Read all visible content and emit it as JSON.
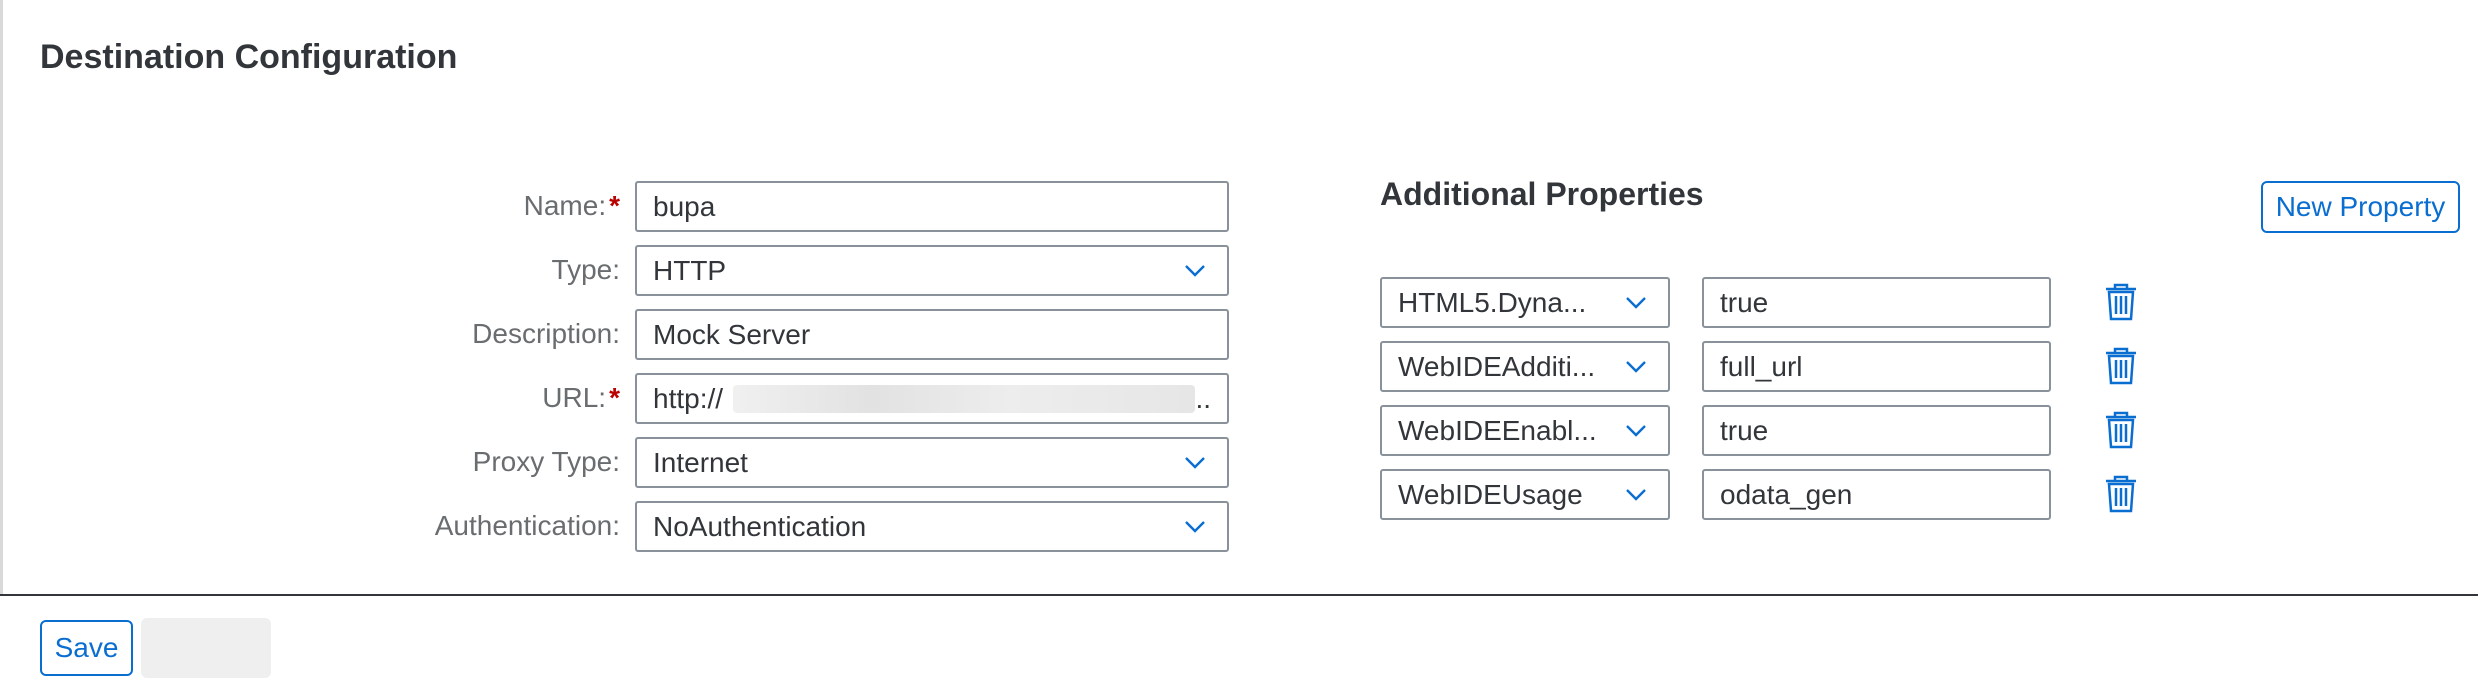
{
  "page": {
    "title": "Destination Configuration"
  },
  "form": {
    "name": {
      "label": "Name:",
      "value": "bupa",
      "required": true
    },
    "type": {
      "label": "Type:",
      "value": "HTTP"
    },
    "description": {
      "label": "Description:",
      "value": "Mock Server"
    },
    "url": {
      "label": "URL:",
      "value": "http://",
      "trail": "..",
      "required": true
    },
    "proxy_type": {
      "label": "Proxy Type:",
      "value": "Internet"
    },
    "authentication": {
      "label": "Authentication:",
      "value": "NoAuthentication"
    }
  },
  "additional_properties": {
    "title": "Additional Properties",
    "new_property_label": "New Property",
    "rows": [
      {
        "key": "HTML5.Dyna...",
        "value": "true"
      },
      {
        "key": "WebIDEAdditi...",
        "value": "full_url"
      },
      {
        "key": "WebIDEEnabl...",
        "value": "true"
      },
      {
        "key": "WebIDEUsage",
        "value": "odata_gen"
      }
    ]
  },
  "footer": {
    "save_label": "Save"
  },
  "icons": {
    "dropdown": "chevron-down-icon",
    "delete": "trash-icon"
  },
  "colors": {
    "accent": "#0a6ed1",
    "required": "#bb0000",
    "text": "#32363a",
    "label": "#6a6d70",
    "border": "#89919a"
  }
}
